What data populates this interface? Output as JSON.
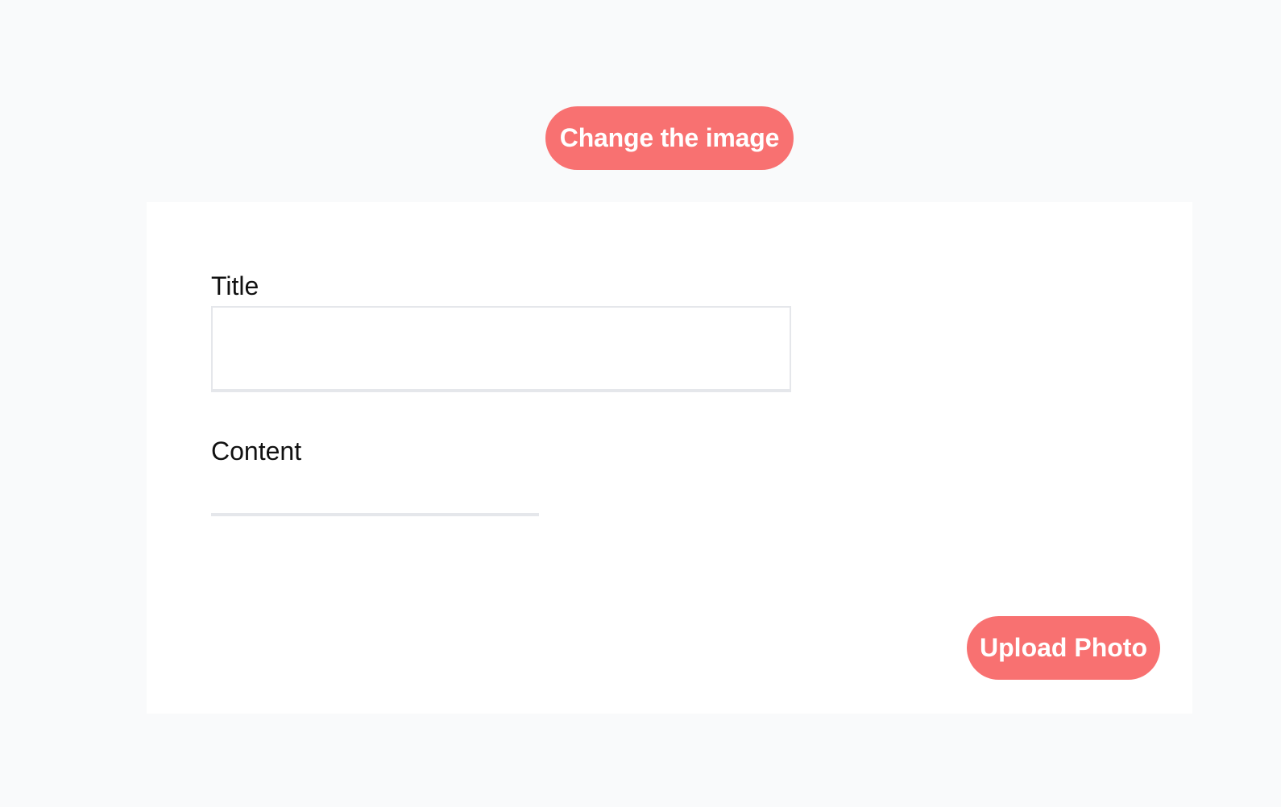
{
  "header": {
    "change_image_label": "Change the image"
  },
  "form": {
    "title_label": "Title",
    "title_value": "",
    "title_placeholder": "",
    "content_label": "Content",
    "content_value": "",
    "content_placeholder": "",
    "upload_photo_label": "Upload Photo"
  },
  "colors": {
    "background": "#f9fafb",
    "card": "#ffffff",
    "accent": "#f87171",
    "input_border": "#e5e7eb",
    "text": "#111111"
  }
}
